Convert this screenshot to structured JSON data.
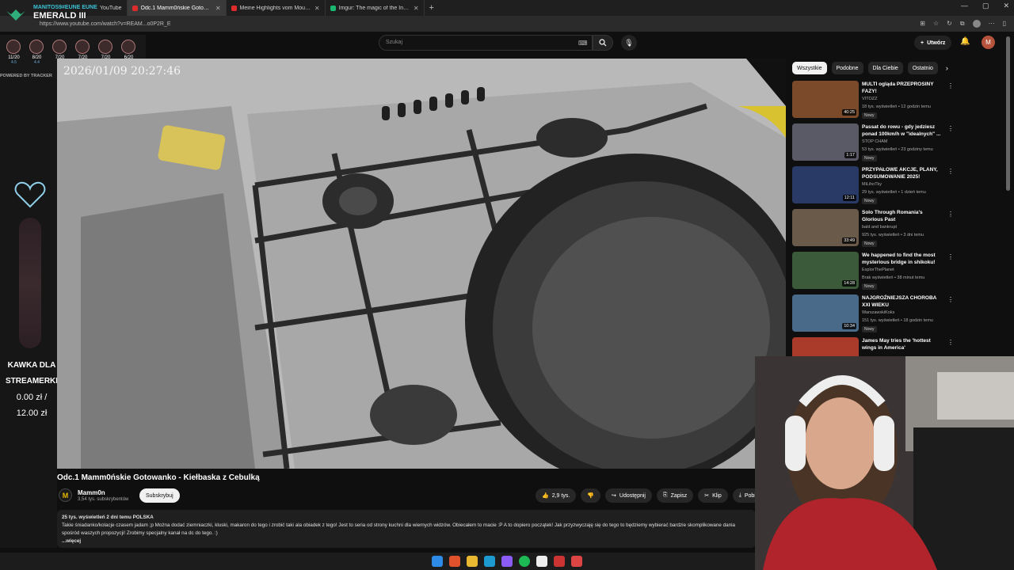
{
  "browser": {
    "tabs": [
      {
        "title": "YouTube",
        "active": false
      },
      {
        "title": "Odc.1 Mamm0ńskie Gotowanko",
        "active": true
      },
      {
        "title": "Meine Highlights vom Mountain",
        "active": false
      },
      {
        "title": "Imgur: The magic of the Internet",
        "active": false
      }
    ],
    "url": "https://www.youtube.com/watch?v=REAM...o0P2R_E"
  },
  "overlay": {
    "title": "EMERALD III",
    "subtitle": "MANITOS9#EUNE EUNE",
    "ranks": [
      {
        "games": "11/20",
        "score": "4.5"
      },
      {
        "games": "8/20",
        "score": "4.4"
      },
      {
        "games": "7/20",
        "score": "3.4"
      },
      {
        "games": "7/20",
        "score": ""
      },
      {
        "games": "7/20",
        "score": ""
      },
      {
        "games": "6/20",
        "score": ""
      }
    ],
    "powered": "POWERED BY TRACKER",
    "donation_label": "KAWKA DLA STREAMERKI",
    "donation_amount_line1": "0.00 zł /",
    "donation_amount_line2": "12.00 zł"
  },
  "masthead": {
    "search_placeholder": "Szukaj",
    "create_label": "Utwórz",
    "avatar_letter": "M"
  },
  "video": {
    "timestamp": "2026/01/09   20:27:46",
    "title": "Odc.1 Mamm0ńskie Gotowanko - Kiełbaska z Cebulką",
    "channel": "Mamm0n",
    "channel_subs": "3,54 tys. subskrybentów",
    "subscribe_label": "Subskrybuj",
    "likes": "2,9 tys.",
    "share_label": "Udostępnij",
    "save_label": "Zapisz",
    "clip_label": "Klip",
    "download_label": "Pobi",
    "desc_meta": "25 tys. wyświetleń  2 dni temu  POLSKA",
    "desc_text": "Takie śniadanko/kolacje czasem jadam ;p Można dodać ziemniaczki, kluski, makaron do tego i zrobić taki ala obiadek z tego! Jest to seria od strony kuchni dla wiernych widzów. Obiecałem to macie :P A to dopiero początek! Jak przyzwyczaję się do tego to będziemy wybierać bardzie skomplikowane dania spośród waszych propozycji! Zrobimy specjalny kanał na dc do tego. :)",
    "desc_more": "...więcej"
  },
  "sidebar": {
    "chips": [
      "Wszystkie",
      "Podobne",
      "Dla Ciebie",
      "Ostatnio"
    ],
    "recs": [
      {
        "title": "MULTI ogląda PRZEPROSINY FAZY!",
        "channel": "VITOZZ",
        "meta": "18 tys. wyświetleń • 12 godzin temu",
        "badge": "Nowy",
        "duration": "40:25",
        "color": "#7a4a2a"
      },
      {
        "title": "Passat do rowu - gdy jedziesz ponad 100km/h w \"idealnych\" ...",
        "channel": "STOP CHAM",
        "meta": "53 tys. wyświetleń • 23 godziny temu",
        "badge": "Nowy",
        "duration": "1:17",
        "color": "#5a5a66"
      },
      {
        "title": "PRZYPAŁOWE AKCJE, PLANY, PODSUMOWANIE 2025!",
        "channel": "MiLihoTky",
        "meta": "29 tys. wyświetleń • 1 dzień temu",
        "badge": "Nowy",
        "duration": "12:11",
        "color": "#2a3a66"
      },
      {
        "title": "Solo Through Romania's Glorious Past",
        "channel": "bald and bankrupt",
        "meta": "925 tys. wyświetleń • 3 dni temu",
        "badge": "Nowy",
        "duration": "33:49",
        "color": "#6a5a4a"
      },
      {
        "title": "We happened to find the most mysterious bridge in shikoku!",
        "channel": "ExplorThePlanet",
        "meta": "Brak wyświetleń • 38 minut temu",
        "badge": "Nowy",
        "duration": "14:28",
        "color": "#3a5a3a"
      },
      {
        "title": "NAJGROŹNIEJSZA CHOROBA XXI WIEKU",
        "channel": "WarszawskiKoks",
        "meta": "151 tys. wyświetleń • 18 godzin temu",
        "badge": "Nowy",
        "duration": "10:34",
        "color": "#4a6a8a"
      },
      {
        "title": "James May tries the 'hottest wings in America'",
        "channel": "",
        "meta": "",
        "badge": "",
        "duration": "",
        "color": "#aa3a2a"
      }
    ]
  }
}
